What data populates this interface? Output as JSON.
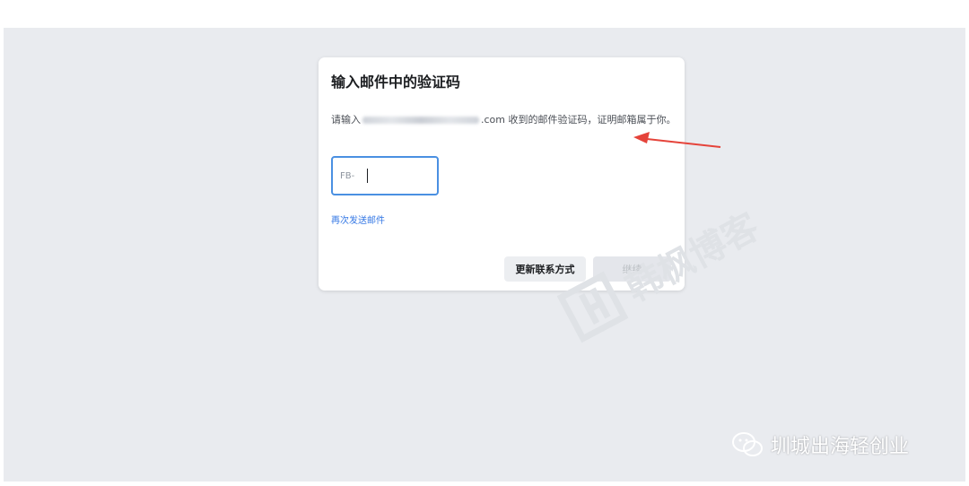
{
  "dialog": {
    "title": "输入邮件中的验证码",
    "description_prefix": "请输入",
    "description_suffix": ".com 收到的邮件验证码，证明邮箱属于你。",
    "code_prefix": "FB-",
    "resend_link": "再次发送邮件",
    "change_contact_button": "更新联系方式",
    "submit_button": "继续"
  },
  "watermark": {
    "text": "韩枫博客"
  },
  "footer": {
    "account_name": "圳城出海轻创业"
  },
  "colors": {
    "accent": "#3578e5",
    "input_border": "#4a90e2",
    "arrow": "#e5433a",
    "background": "#e9ebef"
  }
}
